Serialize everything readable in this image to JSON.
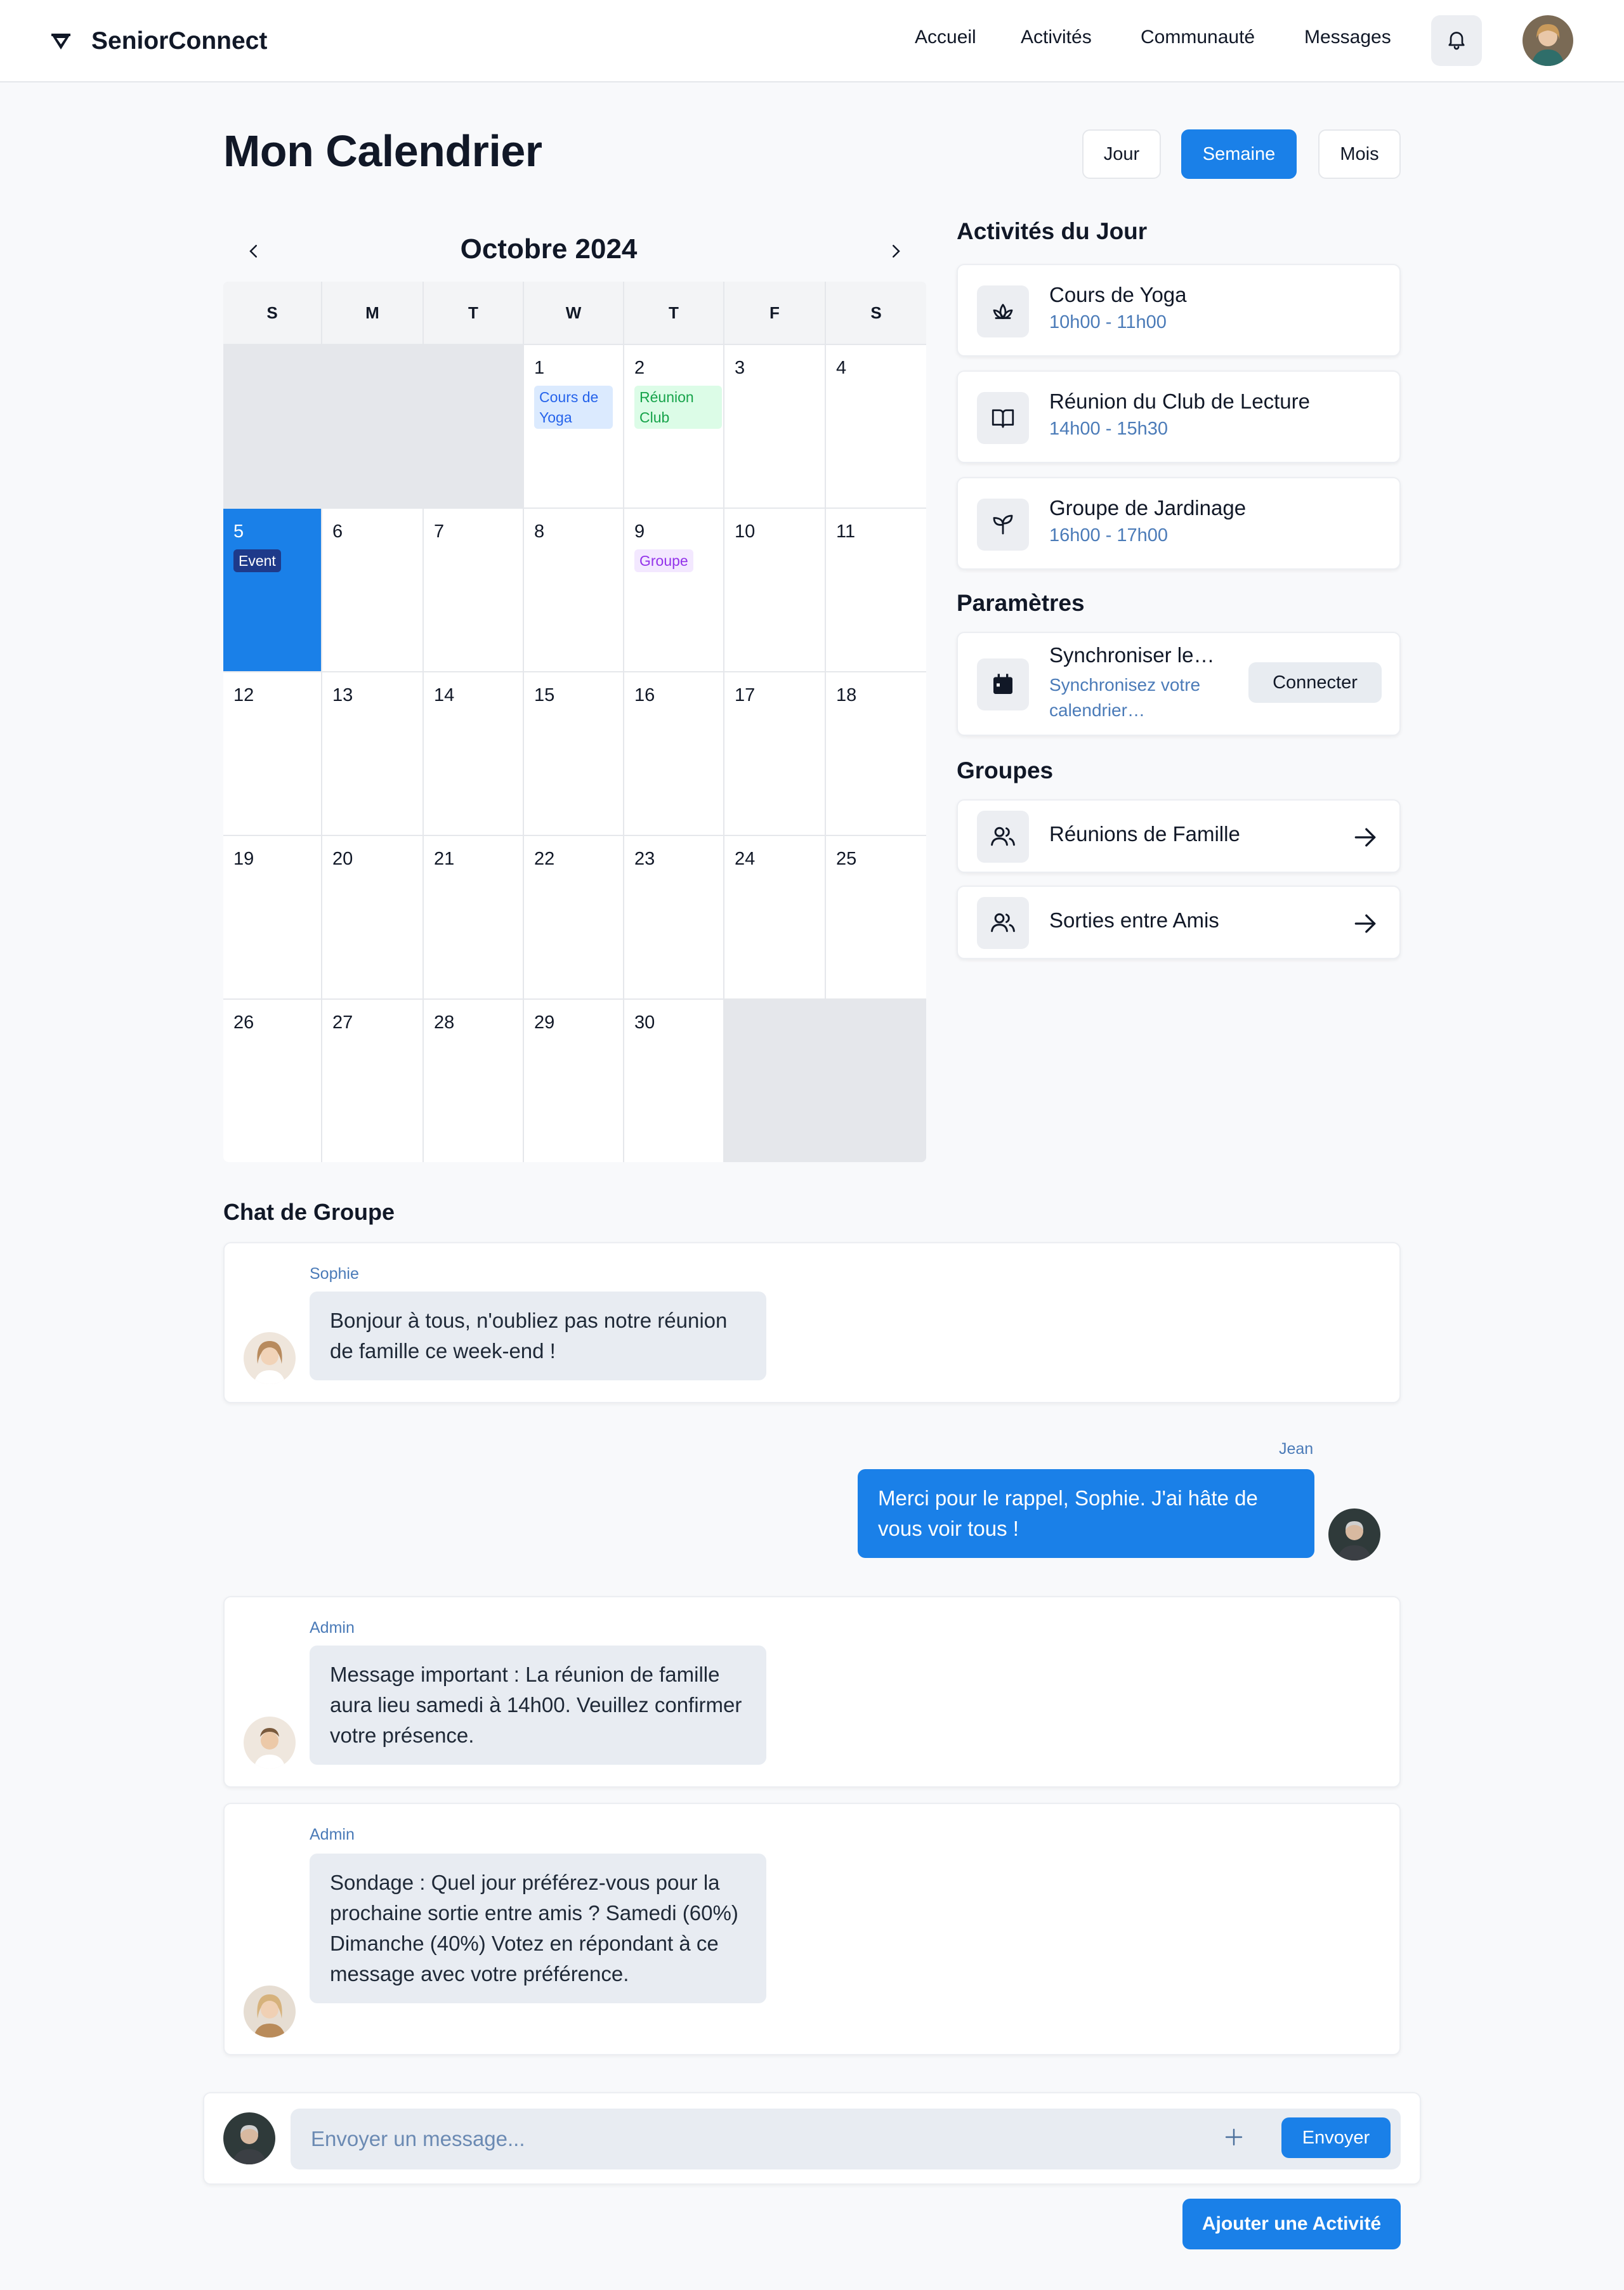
{
  "header": {
    "brand": "SeniorConnect",
    "nav": [
      "Accueil",
      "Activités",
      "Communauté",
      "Messages"
    ]
  },
  "page": {
    "title": "Mon Calendrier",
    "views": [
      "Jour",
      "Semaine",
      "Mois"
    ],
    "active_view": "Semaine"
  },
  "calendar": {
    "month": "Octobre 2024",
    "weekdays": [
      "S",
      "M",
      "T",
      "W",
      "T",
      "F",
      "S"
    ],
    "days": [
      {
        "n": "",
        "empty": true
      },
      {
        "n": "",
        "empty": true
      },
      {
        "n": "",
        "empty": true
      },
      {
        "n": "1",
        "tag": "Cours de Yoga",
        "tag_type": "yoga"
      },
      {
        "n": "2",
        "tag": "Réunion Club",
        "tag_type": "club"
      },
      {
        "n": "3"
      },
      {
        "n": "4"
      },
      {
        "n": "5",
        "today": true,
        "tag": "Event",
        "tag_type": "event"
      },
      {
        "n": "6"
      },
      {
        "n": "7"
      },
      {
        "n": "8"
      },
      {
        "n": "9",
        "tag": "Groupe",
        "tag_type": "groupe"
      },
      {
        "n": "10"
      },
      {
        "n": "11"
      },
      {
        "n": "12"
      },
      {
        "n": "13"
      },
      {
        "n": "14"
      },
      {
        "n": "15"
      },
      {
        "n": "16"
      },
      {
        "n": "17"
      },
      {
        "n": "18"
      },
      {
        "n": "19"
      },
      {
        "n": "20"
      },
      {
        "n": "21"
      },
      {
        "n": "22"
      },
      {
        "n": "23"
      },
      {
        "n": "24"
      },
      {
        "n": "25"
      },
      {
        "n": "26"
      },
      {
        "n": "27"
      },
      {
        "n": "28"
      },
      {
        "n": "29"
      },
      {
        "n": "30"
      },
      {
        "n": "",
        "empty": true
      },
      {
        "n": "",
        "empty": true
      }
    ]
  },
  "activities": {
    "title": "Activités du Jour",
    "items": [
      {
        "title": "Cours de Yoga",
        "time": "10h00 - 11h00",
        "icon": "lotus-icon"
      },
      {
        "title": "Réunion du Club de Lecture",
        "time": "14h00 - 15h30",
        "icon": "book-open-icon"
      },
      {
        "title": "Groupe de Jardinage",
        "time": "16h00 - 17h00",
        "icon": "sprout-icon"
      }
    ]
  },
  "settings": {
    "title": "Paramètres",
    "sync_title": "Synchroniser le…",
    "sync_sub_1": "Synchronisez votre",
    "sync_sub_2": "calendrier…",
    "connect_label": "Connecter"
  },
  "groups": {
    "title": "Groupes",
    "items": [
      {
        "label": "Réunions de Famille"
      },
      {
        "label": "Sorties entre Amis"
      }
    ]
  },
  "chat": {
    "title": "Chat de Groupe",
    "messages": [
      {
        "sender": "Sophie",
        "text": "Bonjour à tous, n'oubliez pas notre réunion de famille ce week-end !"
      },
      {
        "sender": "Jean",
        "text": "Merci pour le rappel, Sophie. J'ai hâte de vous voir tous !"
      },
      {
        "sender": "Admin",
        "text": "Message important : La réunion de famille aura lieu samedi à 14h00. Veuillez confirmer votre présence."
      },
      {
        "sender": "Admin",
        "text": "Sondage : Quel jour préférez-vous pour la prochaine sortie entre amis ? Samedi (60%) Dimanche (40%) Votez en répondant à ce message avec votre préférence."
      }
    ],
    "placeholder": "Envoyer un message...",
    "send_label": "Envoyer"
  },
  "add_activity_label": "Ajouter une Activité",
  "colors": {
    "accent": "#1a80e8",
    "event_tag": "#1e3a8a",
    "sender_name": "#4b7bb8"
  }
}
